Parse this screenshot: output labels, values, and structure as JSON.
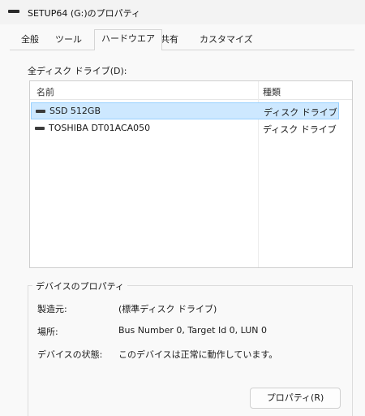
{
  "window": {
    "title": "SETUP64 (G:)のプロパティ",
    "icon": "drive-icon"
  },
  "tabs": [
    {
      "label": "全般"
    },
    {
      "label": "ツール"
    },
    {
      "label": "ハードウエア",
      "active": true
    },
    {
      "label": "共有"
    },
    {
      "label": "カスタマイズ"
    }
  ],
  "drives": {
    "label": "全ディスク ドライブ(D):",
    "columns": {
      "name": "名前",
      "type": "種類"
    },
    "rows": [
      {
        "name": "SSD 512GB",
        "type": "ディスク ドライブ",
        "selected": true,
        "icon": "hdd-icon"
      },
      {
        "name": "TOSHIBA DT01ACA050",
        "type": "ディスク ドライブ",
        "selected": false,
        "icon": "hdd-icon"
      }
    ]
  },
  "device_properties": {
    "title": "デバイスのプロパティ",
    "manufacturer": {
      "label": "製造元:",
      "value": "(標準ディスク ドライブ)"
    },
    "location": {
      "label": "場所:",
      "value": "Bus Number 0, Target Id 0, LUN 0"
    },
    "status": {
      "label": "デバイスの状態:",
      "value": "このデバイスは正常に動作しています。"
    },
    "button_label": "プロパティ(R)"
  }
}
